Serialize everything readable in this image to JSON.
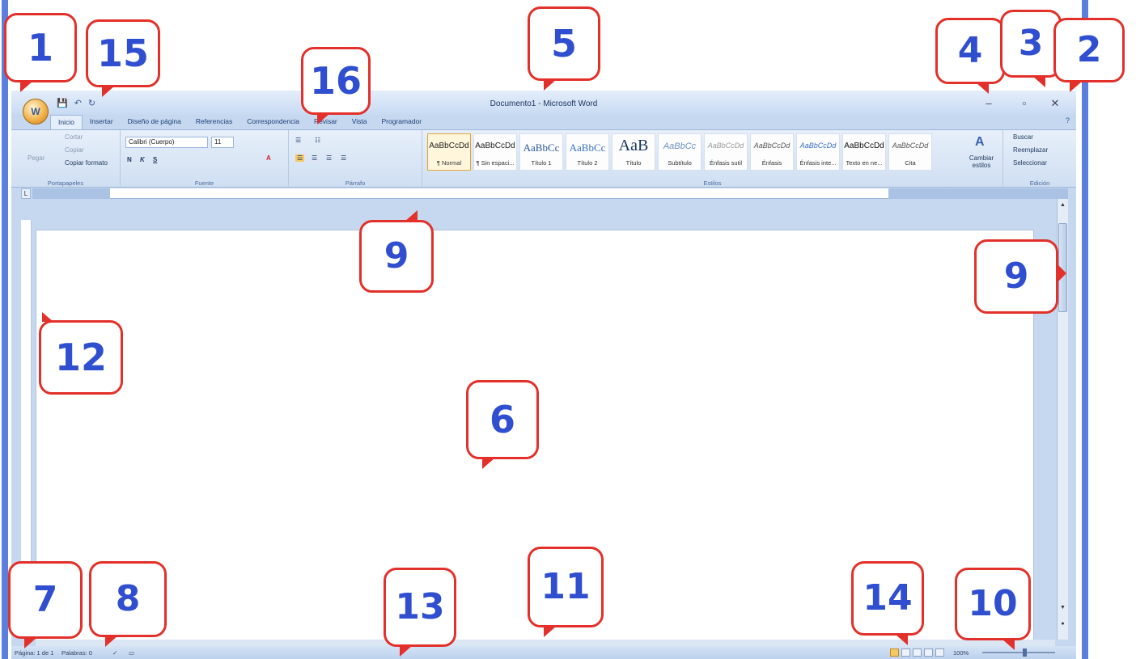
{
  "window": {
    "title": "Documento1 - Microsoft Word",
    "office_button": "W",
    "qat": [
      "save-icon",
      "undo-icon",
      "redo-icon"
    ],
    "controls": {
      "minimize": "–",
      "restore": "▫",
      "close": "✕"
    },
    "help": "?"
  },
  "tabs": [
    "Inicio",
    "Insertar",
    "Diseño de página",
    "Referencias",
    "Correspondencia",
    "Revisar",
    "Vista",
    "Programador"
  ],
  "ribbon": {
    "portapapeles": {
      "label": "Portapapeles",
      "paste": "Pegar",
      "cut": "Cortar",
      "copy": "Copiar",
      "format_painter": "Copiar formato"
    },
    "fuente": {
      "label": "Fuente",
      "font": "Calibri (Cuerpo)",
      "size": "11",
      "bold": "N",
      "italic": "K",
      "underline": "S"
    },
    "parrafo": {
      "label": "Párrafo"
    },
    "estilos": {
      "label": "Estilos",
      "items": [
        {
          "preview": "AaBbCcDd",
          "name": "¶ Normal"
        },
        {
          "preview": "AaBbCcDd",
          "name": "¶ Sin espaci..."
        },
        {
          "preview": "AaBbCc",
          "name": "Título 1"
        },
        {
          "preview": "AaBbCc",
          "name": "Título 2"
        },
        {
          "preview": "AaB",
          "name": "Título"
        },
        {
          "preview": "AaBbCc",
          "name": "Subtítulo"
        },
        {
          "preview": "AaBbCcDd",
          "name": "Énfasis sutil"
        },
        {
          "preview": "AaBbCcDd",
          "name": "Énfasis"
        },
        {
          "preview": "AaBbCcDd",
          "name": "Énfasis inte..."
        },
        {
          "preview": "AaBbCcDd",
          "name": "Texto en ne..."
        },
        {
          "preview": "AaBbCcDd",
          "name": "Cita"
        }
      ],
      "change_styles": "Cambiar estilos"
    },
    "edicion": {
      "label": "Edición",
      "find": "Buscar",
      "replace": "Reemplazar",
      "select": "Seleccionar"
    }
  },
  "status": {
    "page": "Página: 1 de 1",
    "words": "Palabras: 0",
    "zoom": "100%"
  },
  "callouts": [
    "1",
    "15",
    "16",
    "5",
    "4",
    "3",
    "2",
    "9",
    "12",
    "9",
    "6",
    "7",
    "8",
    "13",
    "11",
    "14",
    "10"
  ],
  "colors": {
    "callout_border": "#e3302a",
    "callout_number": "#2f4fd0",
    "frame": "#5a7fe0"
  }
}
